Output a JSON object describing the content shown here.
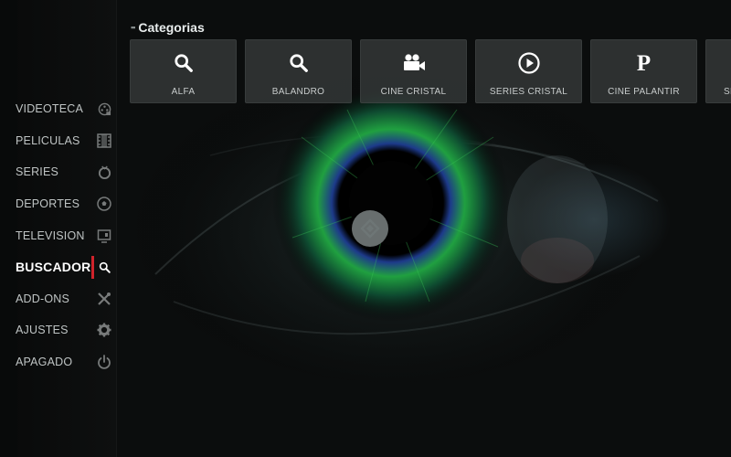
{
  "sidebar": {
    "items": [
      {
        "label": "VIDEOTECA",
        "icon": "film-reel-icon"
      },
      {
        "label": "PELICULAS",
        "icon": "film-strip-icon"
      },
      {
        "label": "SERIES",
        "icon": "tv-icon"
      },
      {
        "label": "DEPORTES",
        "icon": "soccer-ball-icon"
      },
      {
        "label": "TELEVISION",
        "icon": "television-icon"
      },
      {
        "label": "BUSCADOR",
        "icon": "search-icon",
        "active": true
      },
      {
        "label": "ADD-ONS",
        "icon": "tools-icon"
      },
      {
        "label": "AJUSTES",
        "icon": "gear-icon"
      },
      {
        "label": "APAGADO",
        "icon": "power-icon"
      }
    ]
  },
  "categories": {
    "title": "Categorias",
    "tiles": [
      {
        "label": "ALFA",
        "icon": "search-icon"
      },
      {
        "label": "BALANDRO",
        "icon": "search-icon"
      },
      {
        "label": "CINE CRISTAL",
        "icon": "video-camera-icon"
      },
      {
        "label": "SERIES CRISTAL",
        "icon": "play-circle-icon"
      },
      {
        "label": "CINE PALANTIR",
        "icon": "palantir-p-icon",
        "glyph": "P"
      },
      {
        "label": "SE",
        "icon": "partial-tile"
      }
    ]
  },
  "colors": {
    "accent": "#d0232b",
    "tile_bg": "#3a3e3e",
    "sidebar_bg": "#0e1010"
  }
}
